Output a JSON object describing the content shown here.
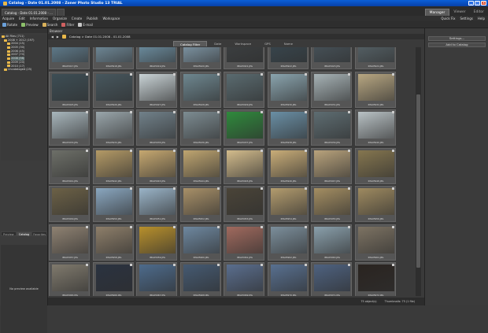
{
  "window": {
    "title": "Catalog - Date 01.01.2008 - Zoner Photo Studio 13 TRIAL"
  },
  "tabs": {
    "doc": "Catalog - Date 01.01.2008 - ..."
  },
  "modes": [
    "Manager",
    "Viewer",
    "Editor"
  ],
  "menu": [
    "Acquire",
    "Edit",
    "Information",
    "Organize",
    "Create",
    "Publish",
    "Workspace"
  ],
  "menu_right": [
    "Quick Fix",
    "Settings",
    "Help"
  ],
  "toolbar": [
    "Rotate",
    "Preview",
    "Search",
    "Filter",
    "E-mail"
  ],
  "browser": {
    "title": "Browser",
    "path": "Catalog > Date 01.01.2008 - 01.01.2008",
    "filter_tabs": [
      "Catalog Filter",
      "Date",
      "Workspace",
      "GPS",
      "Name"
    ],
    "active_filter": "Catalog Filter",
    "status": [
      "75 object(s)",
      "Thumbnails: 75 (1 file)"
    ]
  },
  "left": {
    "tree_header": "",
    "tree": [
      "All Files (711)",
      "2008 + 2012 (197)",
      "2004 (15)",
      "2005 (30)",
      "2006 (45)",
      "2007 (70)",
      "2008 (98)",
      "2009 (20)",
      "2010 (17)",
      "Uncataloged (25)"
    ],
    "selected_tree": "2008 (98)",
    "panel_tabs": [
      "Preview",
      "Catalog",
      "Favorites"
    ],
    "active_panel_tab": "Catalog",
    "preview_text": "No preview available"
  },
  "right": {
    "buttons": [
      "Settings...",
      "Add to Catalog"
    ]
  },
  "thumbnails": [
    {
      "c": "#6a8ca0",
      "cap": "IMG05917.JPG"
    },
    {
      "c": "#7d9cae",
      "cap": "IMG05918.JPG"
    },
    {
      "c": "#78a0b6",
      "cap": "IMG05919.JPG"
    },
    {
      "c": "#8eaabc",
      "cap": "IMG05920.JPG"
    },
    {
      "c": "#3e4244",
      "cap": "IMG05921.JPG"
    },
    {
      "c": "#3a4a53",
      "cap": "IMG05922.JPG"
    },
    {
      "c": "#4b5860",
      "cap": "IMG05923.JPG"
    },
    {
      "c": "#5c6a70",
      "cap": "IMG05924.JPG"
    },
    {
      "c": "#3d4e55",
      "cap": "IMG05925.JPG"
    },
    {
      "c": "#47575e",
      "cap": "IMG05926.JPG"
    },
    {
      "c": "#c9d3d6",
      "cap": "IMG05927.JPG"
    },
    {
      "c": "#6e8790",
      "cap": "IMG05928.JPG"
    },
    {
      "c": "#5a6b70",
      "cap": "IMG05929.JPG"
    },
    {
      "c": "#8aa4ae",
      "cap": "IMG05930.JPG"
    },
    {
      "c": "#a7b3b6",
      "cap": "IMG05931.JPG"
    },
    {
      "c": "#b8a782",
      "cap": "IMG05932.JPG"
    },
    {
      "c": "#a8b6bc",
      "cap": "IMG05933.JPG"
    },
    {
      "c": "#9aa6ab",
      "cap": "IMG05934.JPG"
    },
    {
      "c": "#71818a",
      "cap": "IMG05935.JPG"
    },
    {
      "c": "#7d8c92",
      "cap": "IMG05936.JPG"
    },
    {
      "c": "#2f8a3c",
      "cap": "IMG05937.JPG"
    },
    {
      "c": "#6a8fa5",
      "cap": "IMG05938.JPG"
    },
    {
      "c": "#5e6d72",
      "cap": "IMG05939.JPG"
    },
    {
      "c": "#b9c2c5",
      "cap": "IMG05940.JPG"
    },
    {
      "c": "#6d6f68",
      "cap": "IMG05941.JPG"
    },
    {
      "c": "#b49a66",
      "cap": "IMG05942.JPG"
    },
    {
      "c": "#c6a870",
      "cap": "IMG05943.JPG"
    },
    {
      "c": "#bfa570",
      "cap": "IMG05944.JPG"
    },
    {
      "c": "#d3bc8c",
      "cap": "IMG05945.JPG"
    },
    {
      "c": "#c9ad78",
      "cap": "IMG05946.JPG"
    },
    {
      "c": "#b9a37c",
      "cap": "IMG05947.JPG"
    },
    {
      "c": "#85764f",
      "cap": "IMG05948.JPG"
    },
    {
      "c": "#6c6146",
      "cap": "IMG05949.JPG"
    },
    {
      "c": "#8aa7c0",
      "cap": "IMG05950.JPG"
    },
    {
      "c": "#9ab4c8",
      "cap": "IMG05951.JPG"
    },
    {
      "c": "#a89068",
      "cap": "IMG05952.JPG"
    },
    {
      "c": "#4a4438",
      "cap": "IMG05953.JPG"
    },
    {
      "c": "#b39c6e",
      "cap": "IMG05954.JPG"
    },
    {
      "c": "#a48e62",
      "cap": "IMG05955.JPG"
    },
    {
      "c": "#9e8a60",
      "cap": "IMG05956.JPG"
    },
    {
      "c": "#8f8272",
      "cap": "IMG05957.JPG"
    },
    {
      "c": "#8e7f6a",
      "cap": "IMG05958.JPG"
    },
    {
      "c": "#b8902c",
      "cap": "IMG05959.JPG"
    },
    {
      "c": "#6e88a0",
      "cap": "IMG05960.JPG"
    },
    {
      "c": "#a16a5e",
      "cap": "IMG05961.JPG"
    },
    {
      "c": "#7c8f9c",
      "cap": "IMG05962.JPG"
    },
    {
      "c": "#8aa0ac",
      "cap": "IMG05963.JPG"
    },
    {
      "c": "#7d7363",
      "cap": "IMG05964.JPG"
    },
    {
      "c": "#807a6d",
      "cap": "IMG05965.JPG"
    },
    {
      "c": "#2a3240",
      "cap": "IMG05966.JPG"
    },
    {
      "c": "#4d6b8c",
      "cap": "IMG05967.JPG"
    },
    {
      "c": "#455a72",
      "cap": "IMG05968.JPG"
    },
    {
      "c": "#5a6e8e",
      "cap": "IMG05969.JPG"
    },
    {
      "c": "#587090",
      "cap": "IMG05970.JPG"
    },
    {
      "c": "#4e6280",
      "cap": "IMG05971.JPG"
    },
    {
      "c": "#2a2420",
      "cap": "IMG05972.JPG"
    }
  ]
}
